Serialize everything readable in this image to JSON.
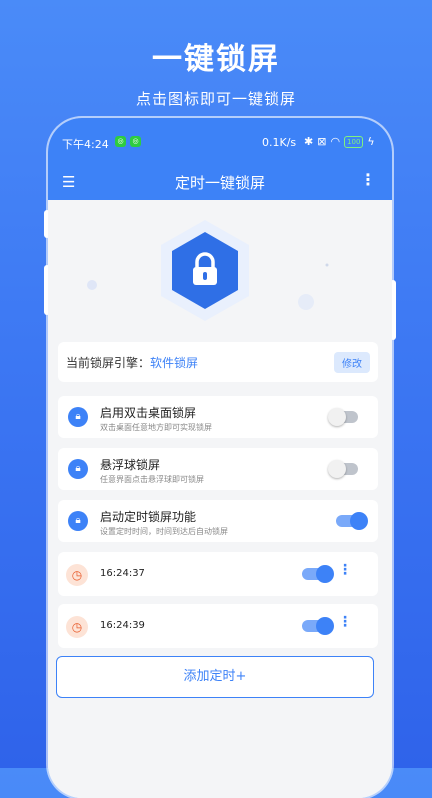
{
  "hero": {
    "title": "一键锁屏",
    "subtitle": "点击图标即可一键锁屏"
  },
  "statusbar": {
    "time": "下午4:24",
    "speed": "0.1K/s",
    "battery": "100"
  },
  "appbar": {
    "menu_icon": "menu-icon",
    "title": "定时一键锁屏",
    "more_icon": "more-vertical-icon"
  },
  "engine": {
    "label": "当前锁屏引擎：",
    "value": "软件锁屏",
    "edit_label": "修改"
  },
  "options": [
    {
      "title": "启用双击桌面锁屏",
      "desc": "双击桌面任意地方即可实现锁屏",
      "enabled": false
    },
    {
      "title": "悬浮球锁屏",
      "desc": "任意界面点击悬浮球即可锁屏",
      "enabled": false
    },
    {
      "title": "启动定时锁屏功能",
      "desc": "设置定时时间，时间到达后自动锁屏",
      "enabled": true
    }
  ],
  "timers": [
    {
      "time": "16:24:37",
      "enabled": true
    },
    {
      "time": "16:24:39",
      "enabled": true
    }
  ],
  "add_timer_label": "添加定时+",
  "colors": {
    "primary": "#3d82f7",
    "background": "#3a74f2",
    "clock_accent": "#e85a2a"
  }
}
